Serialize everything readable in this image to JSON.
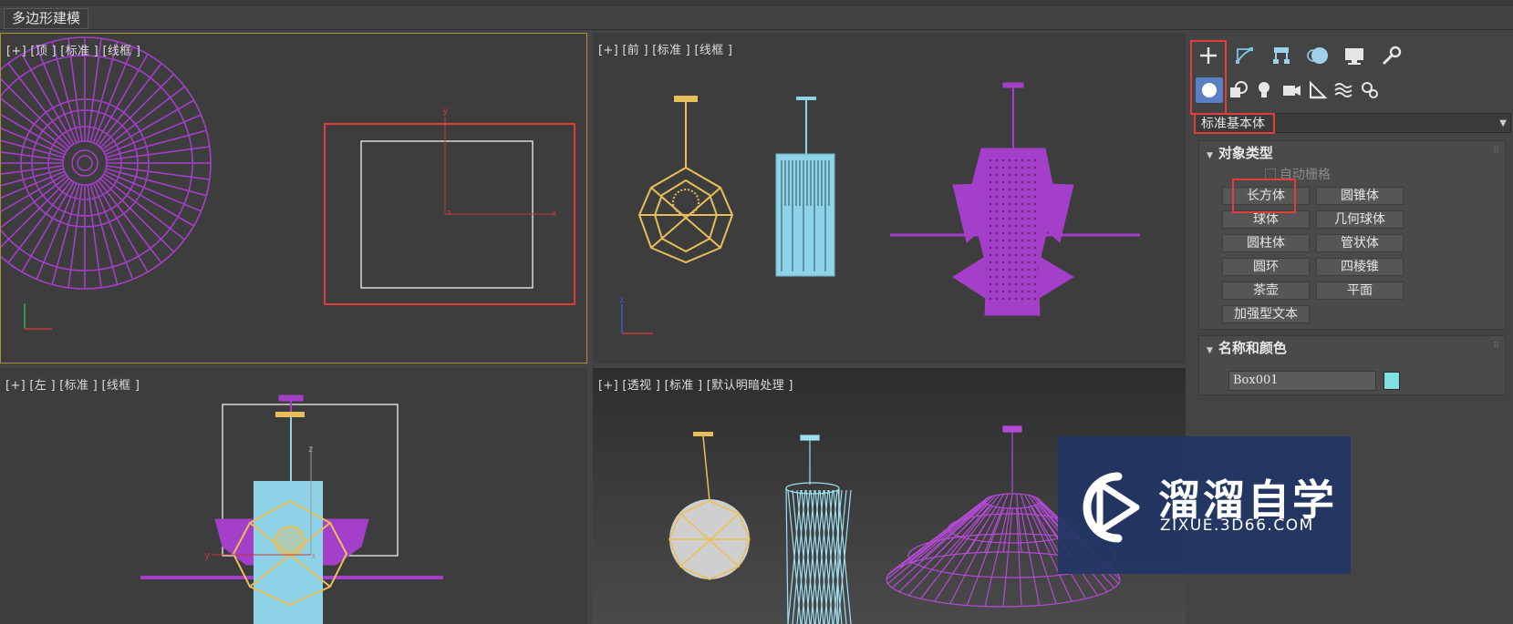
{
  "ribbon": {
    "tab_label": "多边形建模"
  },
  "viewports": {
    "top": {
      "label": "[+] [顶 ] [标准 ] [线框 ]"
    },
    "front": {
      "label": "[+] [前 ] [标准 ] [线框 ]"
    },
    "left": {
      "label": "[+] [左 ] [标准 ] [线框 ]"
    },
    "perspective": {
      "label": "[+] [透视 ] [标准 ] [默认明暗处理 ]"
    }
  },
  "command_panel": {
    "tabs": [
      "create-icon",
      "modify-icon",
      "hierarchy-icon",
      "motion-icon",
      "display-icon",
      "utilities-icon"
    ],
    "subtabs": [
      "geometry-icon",
      "shapes-icon",
      "lights-icon",
      "cameras-icon",
      "helpers-icon",
      "spacewarps-icon",
      "systems-icon"
    ],
    "category_dropdown": "标准基本体",
    "object_type": {
      "title": "对象类型",
      "autogrid_label": "自动栅格",
      "buttons": [
        "长方体",
        "圆锥体",
        "球体",
        "几何球体",
        "圆柱体",
        "管状体",
        "圆环",
        "四棱锥",
        "茶壶",
        "平面",
        "加强型文本"
      ]
    },
    "name_color": {
      "title": "名称和颜色",
      "name_value": "Box001",
      "color": "#7fe1e1"
    }
  },
  "watermark": {
    "title": "溜溜自学",
    "url": "ZIXUE.3D66.COM"
  },
  "colors": {
    "highlight": "#e23c3c",
    "magenta_lamp": "#a43fc9",
    "yellow_lamp": "#e8c05a",
    "cyan_lamp": "#8fd3e8",
    "active_viewport_border": "#a98f3c"
  }
}
